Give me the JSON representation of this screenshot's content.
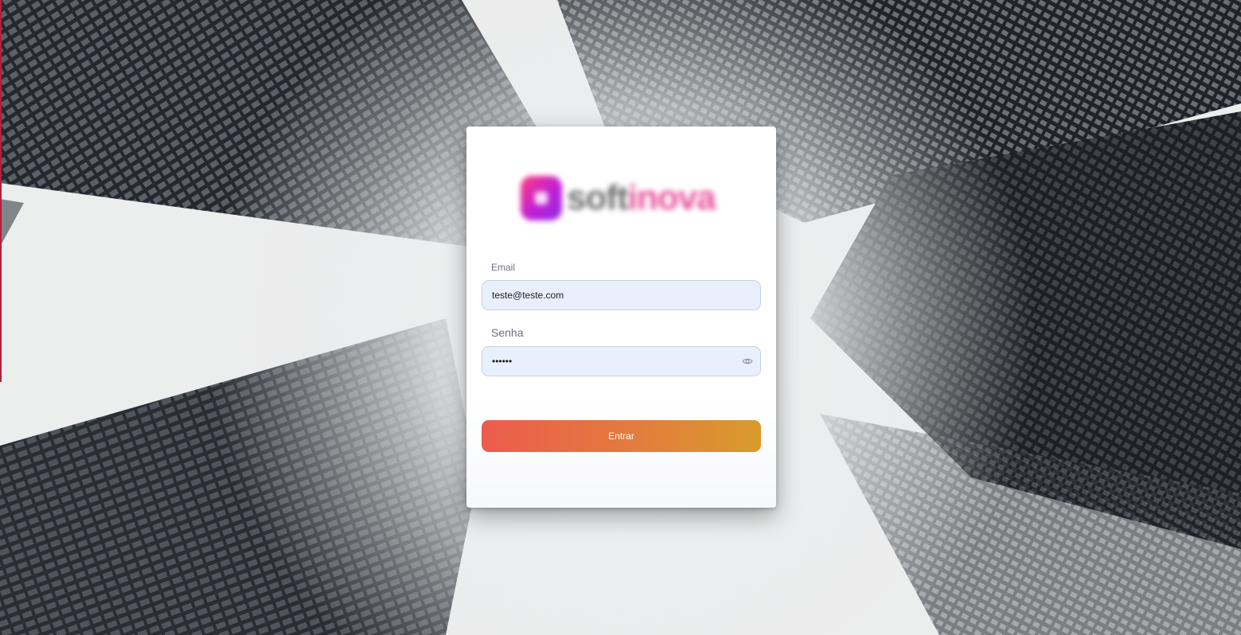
{
  "brand": {
    "name_part1": "soft",
    "name_part2": "inova",
    "mark_color": "#c21fd6",
    "accent_color": "#e9539b"
  },
  "login": {
    "email_label": "Email",
    "email_value": "teste@teste.com",
    "password_label": "Senha",
    "password_value": "teste1",
    "show_password_icon": "eye-icon",
    "submit_label": "Entrar",
    "submit_gradient": [
      "#ec5b4d",
      "#d89b2c"
    ]
  },
  "background": {
    "image": "skyscrapers-looking-up",
    "sky_color": "#e9eaec",
    "building_color": "#2b2e33"
  }
}
